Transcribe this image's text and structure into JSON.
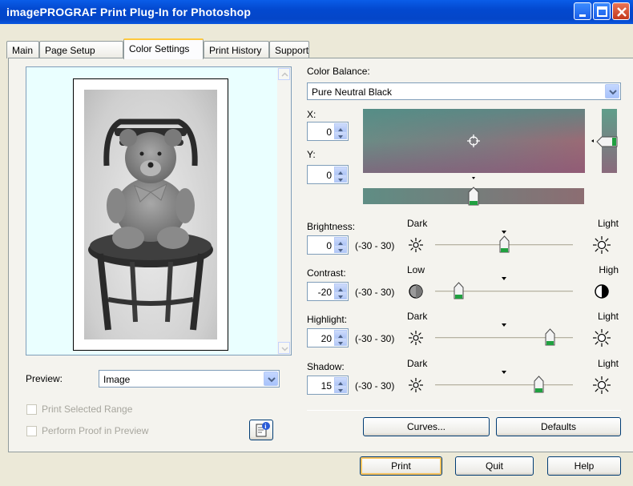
{
  "window": {
    "title": "imagePROGRAF Print Plug-In for Photoshop"
  },
  "tabs": [
    "Main",
    "Page Setup",
    "Color Settings",
    "Print History",
    "Support"
  ],
  "preview": {
    "label": "Preview:",
    "selected": "Image"
  },
  "options": {
    "print_selected_range": "Print Selected Range",
    "perform_proof": "Perform Proof in Preview"
  },
  "color_balance": {
    "label": "Color Balance:",
    "selected": "Pure Neutral Black",
    "x_label": "X:",
    "x_value": "0",
    "y_label": "Y:",
    "y_value": "0"
  },
  "adjust": [
    {
      "label": "Brightness:",
      "value": "0",
      "range": "(-30 - 30)",
      "low": "Dark",
      "high": "Light",
      "pos": 0.5
    },
    {
      "label": "Contrast:",
      "value": "-20",
      "range": "(-30 - 30)",
      "low": "Low",
      "high": "High",
      "pos": 0.17
    },
    {
      "label": "Highlight:",
      "value": "20",
      "range": "(-30 - 30)",
      "low": "Dark",
      "high": "Light",
      "pos": 0.83
    },
    {
      "label": "Shadow:",
      "value": "15",
      "range": "(-30 - 30)",
      "low": "Dark",
      "high": "Light",
      "pos": 0.75
    }
  ],
  "buttons": {
    "curves": "Curves...",
    "defaults": "Defaults",
    "print": "Print",
    "quit": "Quit",
    "help": "Help"
  }
}
